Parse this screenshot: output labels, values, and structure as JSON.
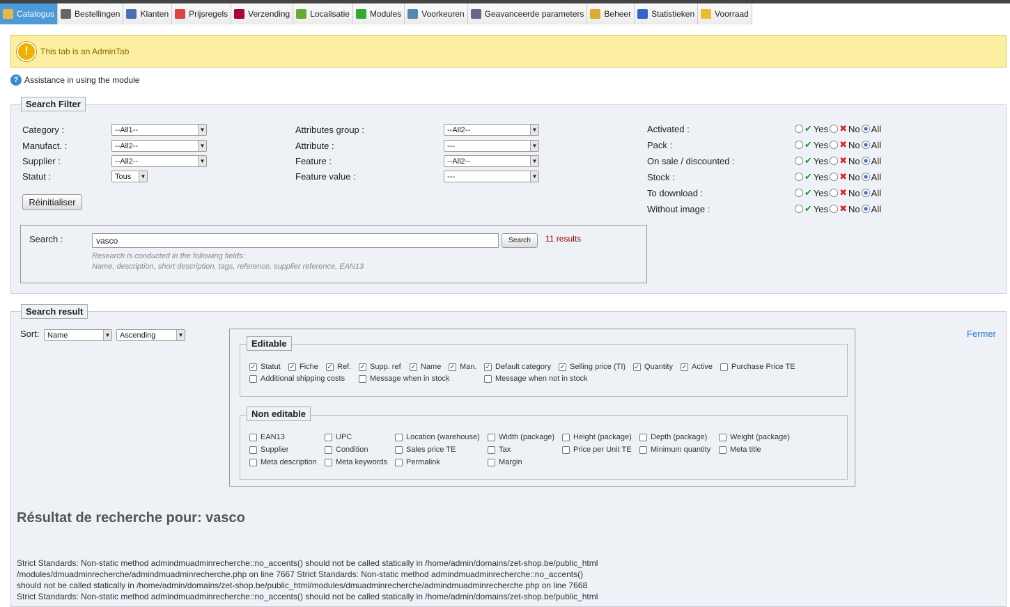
{
  "tabs": [
    {
      "label": "Catalogus",
      "icon": "folder-icon",
      "color": "#e8b844"
    },
    {
      "label": "Bestellingen",
      "icon": "cart-icon",
      "color": "#666"
    },
    {
      "label": "Klanten",
      "icon": "user-icon",
      "color": "#4a6fb5"
    },
    {
      "label": "Prijsregels",
      "icon": "price-rule-icon",
      "color": "#d44"
    },
    {
      "label": "Verzending",
      "icon": "truck-icon",
      "color": "#a04"
    },
    {
      "label": "Localisatie",
      "icon": "globe-icon",
      "color": "#6a3"
    },
    {
      "label": "Modules",
      "icon": "puzzle-icon",
      "color": "#3a3"
    },
    {
      "label": "Voorkeuren",
      "icon": "preferences-icon",
      "color": "#58a"
    },
    {
      "label": "Geavanceerde parameters",
      "icon": "wrench-icon",
      "color": "#668"
    },
    {
      "label": "Beheer",
      "icon": "key-icon",
      "color": "#da3"
    },
    {
      "label": "Statistieken",
      "icon": "chart-icon",
      "color": "#36c"
    },
    {
      "label": "Voorraad",
      "icon": "stock-icon",
      "color": "#eb3"
    }
  ],
  "warning": "This tab is an AdminTab",
  "assist": "Assistance in using the module",
  "filter": {
    "legend": "Search Filter",
    "category_label": "Category :",
    "category_value": "--All1--",
    "manufact_label": "Manufact. :",
    "manufact_value": "--All2--",
    "supplier_label": "Supplier :",
    "supplier_value": "--All2--",
    "statut_label": "Statut :",
    "statut_value": "Tous",
    "attrgroup_label": "Attributes group :",
    "attrgroup_value": "--All2--",
    "attribute_label": "Attribute :",
    "attribute_value": "---",
    "feature_label": "Feature :",
    "feature_value": "--All2--",
    "featurevalue_label": "Feature value :",
    "featurevalue_value": "---",
    "reset": "Réinitialiser",
    "flags": [
      {
        "label": "Activated :"
      },
      {
        "label": "Pack :"
      },
      {
        "label": "On sale / discounted :"
      },
      {
        "label": "Stock :"
      },
      {
        "label": "To download :"
      },
      {
        "label": "Without image :"
      }
    ],
    "yes": "Yes",
    "no": "No",
    "all": "All",
    "search_label": "Search :",
    "search_value": "vasco",
    "search_btn": "Search",
    "results": "11 results",
    "hint1": "Research is conducted in the following fields:",
    "hint2": "Name, description, short description, tags, reference, supplier reference, EAN13"
  },
  "result": {
    "legend": "Search result",
    "sort_label": "Sort:",
    "sort_field": "Name",
    "sort_order": "Ascending",
    "close": "Fermer",
    "editable_legend": "Editable",
    "editable": [
      {
        "label": "Statut",
        "checked": true
      },
      {
        "label": "Fiche",
        "checked": true
      },
      {
        "label": "Ref.",
        "checked": true
      },
      {
        "label": "Supp. ref",
        "checked": true
      },
      {
        "label": "Name",
        "checked": true
      },
      {
        "label": "Man.",
        "checked": true
      },
      {
        "label": "Default category",
        "checked": true
      },
      {
        "label": "Selling price (TI)",
        "checked": true
      },
      {
        "label": "Quantity",
        "checked": true
      },
      {
        "label": "Active",
        "checked": true
      },
      {
        "label": "Purchase Price TE",
        "checked": false
      },
      {
        "label": "Additional shipping costs",
        "checked": false
      },
      {
        "label": "Message when in stock",
        "checked": false
      },
      {
        "label": "Message when not in stock",
        "checked": false
      }
    ],
    "noneditable_legend": "Non editable",
    "noneditable": [
      [
        "EAN13",
        "UPC",
        "Location (warehouse)",
        "Width (package)",
        "Height (package)",
        "Depth (package)",
        "Weight (package)"
      ],
      [
        "Supplier",
        "Condition",
        "Sales price TE",
        "Tax",
        "Price per Unit TE",
        "Minimum quantity",
        "Meta title"
      ],
      [
        "Meta description",
        "Meta keywords",
        "Permalink",
        "Margin"
      ]
    ],
    "heading": "Résultat de recherche pour: vasco",
    "errors": [
      "Strict Standards: Non-static method admindmuadminrecherche::no_accents() should not be called statically in /home/admin/domains/zet-shop.be/public_html",
      "/modules/dmuadminrecherche/admindmuadminrecherche.php on line 7667 Strict Standards: Non-static method admindmuadminrecherche::no_accents()",
      "should not be called statically in /home/admin/domains/zet-shop.be/public_html/modules/dmuadminrecherche/admindmuadminrecherche.php on line 7668",
      "Strict Standards: Non-static method admindmuadminrecherche::no_accents() should not be called statically in /home/admin/domains/zet-shop.be/public_html"
    ]
  }
}
